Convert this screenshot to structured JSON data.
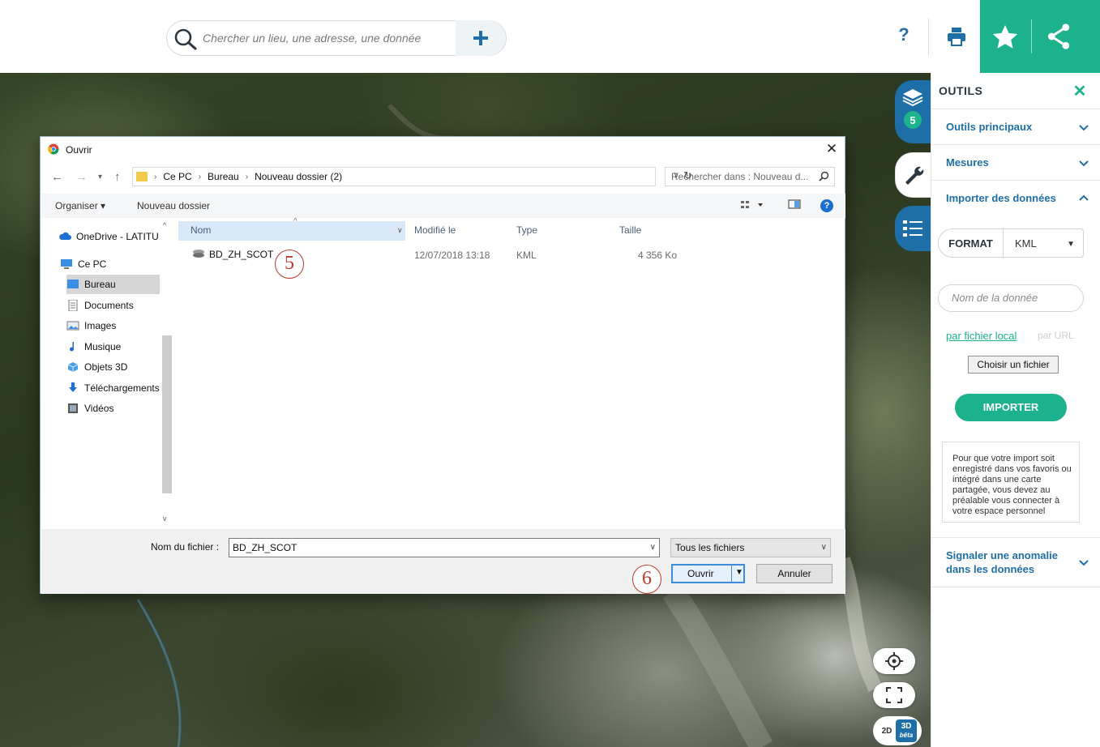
{
  "search": {
    "placeholder": "Chercher un lieu, une adresse, une donnée"
  },
  "header": {
    "help_label": "?"
  },
  "map": {
    "layers_count": "5",
    "view_2d": "2D",
    "view_3d": "3D",
    "view_3d_badge": "bêta"
  },
  "panel": {
    "title": "OUTILS",
    "close_label": "✕",
    "sections": {
      "main_tools": "Outils principaux",
      "measures": "Mesures",
      "import": "Importer des données",
      "report": "Signaler une anomalie dans les données"
    },
    "format_label": "FORMAT",
    "format_value": "KML",
    "name_placeholder": "Nom de la donnée",
    "link_local": "par fichier local",
    "link_url": "par URL",
    "choose_file": "Choisir un fichier",
    "import_button": "IMPORTER",
    "info_text": "Pour que votre import soit enregistré dans vos favoris ou intégré dans une carte partagée, vous devez au préalable vous connecter à votre espace personnel"
  },
  "dialog": {
    "title": "Ouvrir",
    "breadcrumb": [
      "Ce PC",
      "Bureau",
      "Nouveau dossier (2)"
    ],
    "search_placeholder": "Rechercher dans : Nouveau d...",
    "toolbar": {
      "organize": "Organiser ▾",
      "new_folder": "Nouveau dossier"
    },
    "nav": [
      {
        "label": "OneDrive - LATITU",
        "icon": "cloud-icon"
      },
      {
        "label": "Ce PC",
        "icon": "computer-icon"
      },
      {
        "label": "Bureau",
        "icon": "desktop-icon",
        "selected": true
      },
      {
        "label": "Documents",
        "icon": "document-icon"
      },
      {
        "label": "Images",
        "icon": "image-icon"
      },
      {
        "label": "Musique",
        "icon": "music-icon"
      },
      {
        "label": "Objets 3D",
        "icon": "cube-icon"
      },
      {
        "label": "Téléchargements",
        "icon": "download-icon"
      },
      {
        "label": "Vidéos",
        "icon": "video-icon"
      }
    ],
    "columns": {
      "name": "Nom",
      "modified": "Modifié le",
      "type": "Type",
      "size": "Taille"
    },
    "files": [
      {
        "name": "BD_ZH_SCOT",
        "modified": "12/07/2018 13:18",
        "type": "KML",
        "size": "4 356 Ko"
      }
    ],
    "filename_label": "Nom du fichier :",
    "filename_value": "BD_ZH_SCOT",
    "filetype": "Tous les fichiers",
    "open_button": "Ouvrir",
    "cancel_button": "Annuler"
  },
  "annotations": {
    "step5": "5",
    "step6": "6"
  },
  "colors": {
    "accent_green": "#1bb28c",
    "accent_blue": "#1e6fa8",
    "annotation_red": "#c0392b"
  }
}
